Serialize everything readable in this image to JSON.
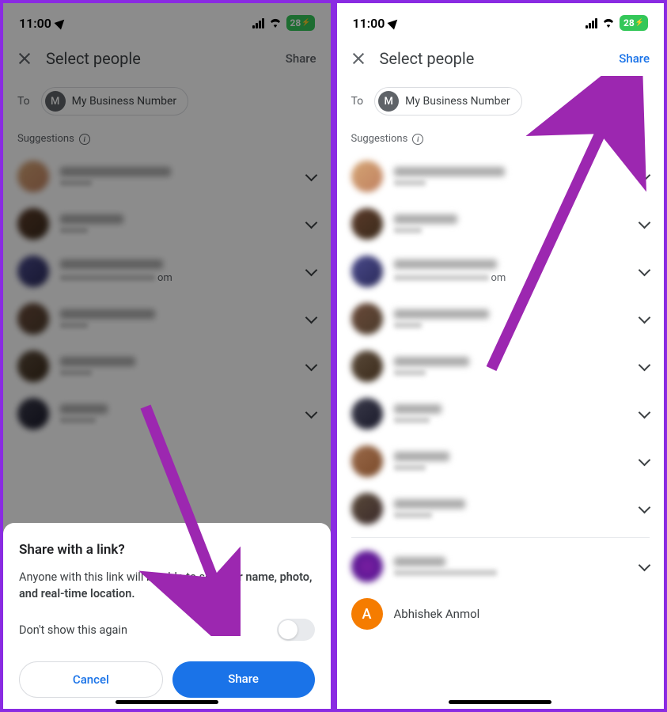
{
  "status": {
    "time": "11:00",
    "battery": "28"
  },
  "header": {
    "title": "Select people",
    "share": "Share"
  },
  "to": {
    "label": "To",
    "chip_letter": "M",
    "chip_label": "My Business Number"
  },
  "suggestions_label": "Suggestions",
  "contact_suffix": "om",
  "sheet": {
    "title": "Share with a link?",
    "body_prefix": "Anyone with this link will be able to see ",
    "body_bold": "your name, photo, and real-time location.",
    "toggle": "Don't show this again",
    "cancel": "Cancel",
    "share": "Share"
  },
  "visible_contact": {
    "initial": "A",
    "name": "Abhishek Anmol"
  }
}
